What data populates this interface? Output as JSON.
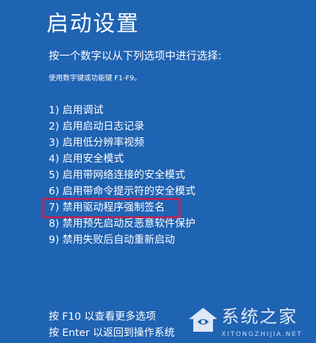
{
  "screen": {
    "title": "启动设置",
    "subtitle": "按一个数字以从下列选项中进行选择:",
    "hint": "使用数字键或功能键 F1-F9。"
  },
  "options": [
    {
      "label": "1) 启用调试"
    },
    {
      "label": "2) 启用启动日志记录"
    },
    {
      "label": "3) 启用低分辨率视频"
    },
    {
      "label": "4) 启用安全模式"
    },
    {
      "label": "5) 启用带网络连接的安全模式"
    },
    {
      "label": "6) 启用带命令提示符的安全模式"
    },
    {
      "label": "7) 禁用驱动程序强制签名",
      "highlighted": true
    },
    {
      "label": "8) 禁用预先启动反恶意软件保护"
    },
    {
      "label": "9) 禁用失败后自动重新启动"
    }
  ],
  "footer": {
    "line1": "按 F10 以查看更多选项",
    "line2": "按 Enter 以返回到操作系统"
  },
  "watermark": {
    "text": "系统之家",
    "sub": "XITONGZHIJIA.NET",
    "icon": "house-logo-icon"
  },
  "colors": {
    "background": "#1f63b3",
    "text": "#ffffff",
    "highlight_border": "#b0285a"
  }
}
